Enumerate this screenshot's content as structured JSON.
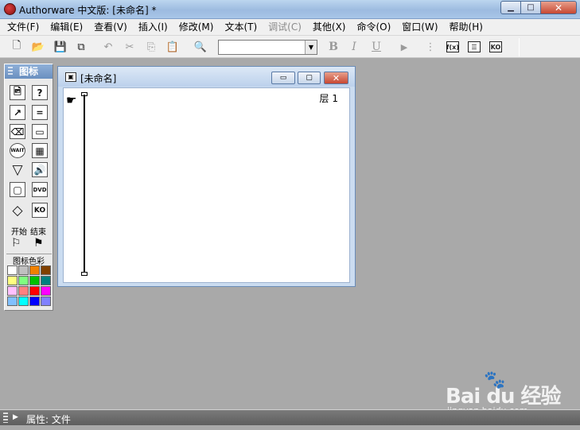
{
  "window": {
    "title": "Authorware 中文版: [未命名] *",
    "min_glyph": "▁",
    "max_glyph": "□",
    "close_glyph": "✕"
  },
  "menu": [
    {
      "label": "文件(F)",
      "enabled": true
    },
    {
      "label": "编辑(E)",
      "enabled": true
    },
    {
      "label": "查看(V)",
      "enabled": true
    },
    {
      "label": "插入(I)",
      "enabled": true
    },
    {
      "label": "修改(M)",
      "enabled": true
    },
    {
      "label": "文本(T)",
      "enabled": true
    },
    {
      "label": "调试(C)",
      "enabled": false
    },
    {
      "label": "其他(X)",
      "enabled": true
    },
    {
      "label": "命令(O)",
      "enabled": true
    },
    {
      "label": "窗口(W)",
      "enabled": true
    },
    {
      "label": "帮助(H)",
      "enabled": true
    }
  ],
  "toolbar": {
    "new_glyph": "🗋",
    "open_glyph": "📂",
    "save_all_glyph": "💾",
    "import_glyph": "⧉",
    "undo_glyph": "↶",
    "cut_glyph": "✂",
    "copy_glyph": "⎘",
    "paste_glyph": "📋",
    "find_glyph": "🔍",
    "font_value": "",
    "bold_label": "B",
    "italic_label": "I",
    "underline_label": "U",
    "run_glyph": "▶",
    "trace_glyph": "⋮",
    "functions_label": "f(x)",
    "variables_label": "☰",
    "knowledge_objects_label": "KO"
  },
  "palette": {
    "title": "图标",
    "icons": [
      {
        "name": "display",
        "glyph": "🖻"
      },
      {
        "name": "interaction",
        "glyph": "?"
      },
      {
        "name": "motion",
        "glyph": "↗"
      },
      {
        "name": "calculation",
        "glyph": "="
      },
      {
        "name": "erase",
        "glyph": "⌫"
      },
      {
        "name": "navigate",
        "glyph": "▭"
      },
      {
        "name": "wait",
        "glyph": "WAIT"
      },
      {
        "name": "framework",
        "glyph": "▦"
      },
      {
        "name": "decision",
        "glyph": "▽"
      },
      {
        "name": "sound",
        "glyph": "🔊"
      },
      {
        "name": "map",
        "glyph": "▢"
      },
      {
        "name": "digital-movie",
        "glyph": "DVD"
      },
      {
        "name": "diamond",
        "glyph": "◇"
      },
      {
        "name": "knowledge-object",
        "glyph": "KO"
      }
    ],
    "start_label": "开始",
    "end_label": "结束",
    "start_flag": "⚐",
    "end_flag": "⚑",
    "colors_label": "图标色彩",
    "colors": [
      "#ffffff",
      "#c0c0c0",
      "#f08000",
      "#804000",
      "#ffff80",
      "#80ff80",
      "#00c000",
      "#008080",
      "#ffc0ff",
      "#ff8080",
      "#ff0000",
      "#ff00ff",
      "#80c0ff",
      "#00ffff",
      "#0000ff",
      "#8080ff"
    ]
  },
  "document": {
    "title": "[未命名]",
    "layer_label": "层 1",
    "hand_glyph": "☛",
    "min_glyph": "▭",
    "max_glyph": "▢",
    "close_glyph": "✕"
  },
  "watermark": {
    "logo_text": "Bai  du 经验",
    "paw_glyph": "🐾",
    "url": "jingyan.baidu.com"
  },
  "properties": {
    "arrow_glyph": "▶",
    "label": "属性: 文件"
  }
}
